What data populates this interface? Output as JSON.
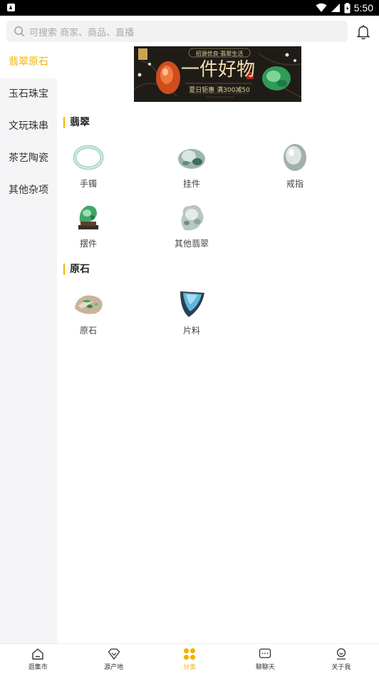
{
  "status_bar": {
    "time": "5:50"
  },
  "search": {
    "placeholder": "可搜索 商家、商品、直播"
  },
  "sidebar": {
    "items": [
      {
        "label": "翡翠原石",
        "active": true
      },
      {
        "label": "玉石珠宝",
        "active": false
      },
      {
        "label": "文玩珠串",
        "active": false
      },
      {
        "label": "茶艺陶瓷",
        "active": false
      },
      {
        "label": "其他杂项",
        "active": false
      }
    ]
  },
  "banner": {
    "top_text": "招源优良·翡翠生活",
    "headline": "一件好物",
    "sub_text": "夏日钜惠 满300减50"
  },
  "sections": [
    {
      "title": "翡翠",
      "items": [
        "手镯",
        "挂件",
        "戒指",
        "摆件",
        "其他翡翠"
      ]
    },
    {
      "title": "原石",
      "items": [
        "原石",
        "片料"
      ]
    }
  ],
  "tabbar": {
    "tabs": [
      {
        "label": "逛集市",
        "icon": "home-icon"
      },
      {
        "label": "源产地",
        "icon": "diamond-icon"
      },
      {
        "label": "分类",
        "icon": "category-icon"
      },
      {
        "label": "聊聊天",
        "icon": "chat-icon"
      },
      {
        "label": "关于我",
        "icon": "profile-icon"
      }
    ],
    "active_color": "#f2b300"
  },
  "colors": {
    "accent": "#f2b300",
    "sidebar_bg": "#f5f5f7"
  }
}
